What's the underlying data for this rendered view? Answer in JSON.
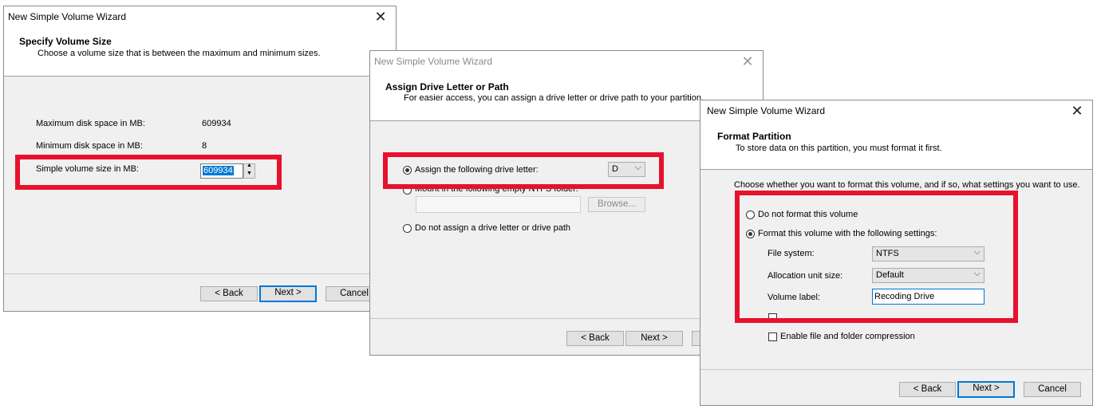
{
  "wizard1": {
    "title": "New Simple Volume Wizard",
    "heading": "Specify Volume Size",
    "subheading": "Choose a volume size that is between the maximum and minimum sizes.",
    "max_label": "Maximum disk space in MB:",
    "max_value": "609934",
    "min_label": "Minimum disk space in MB:",
    "min_value": "8",
    "size_label": "Simple volume size in MB:",
    "size_value": "609934",
    "back": "< Back",
    "next": "Next >",
    "cancel": "Cancel"
  },
  "wizard2": {
    "title": "New Simple Volume Wizard",
    "heading": "Assign Drive Letter or Path",
    "subheading": "For easier access, you can assign a drive letter or drive path to your partition.",
    "option_letter": "Assign the following drive letter:",
    "drive_letter": "D",
    "option_mount": "Mount in the following empty NTFS folder:",
    "browse": "Browse...",
    "option_none": "Do not assign a drive letter or drive path",
    "back": "< Back",
    "next": "Next >"
  },
  "wizard3": {
    "title": "New Simple Volume Wizard",
    "heading": "Format Partition",
    "subheading": "To store data on this partition, you must format it first.",
    "intro": "Choose whether you want to format this volume, and if so, what settings you want to use.",
    "option_noformat": "Do not format this volume",
    "option_format": "Format this volume with the following settings:",
    "fs_label": "File system:",
    "fs_value": "NTFS",
    "alloc_label": "Allocation unit size:",
    "alloc_value": "Default",
    "vol_label": "Volume label:",
    "vol_value": "Recoding Drive",
    "compression": "Enable file and folder compression",
    "back": "< Back",
    "next": "Next >",
    "cancel": "Cancel"
  },
  "highlight_color": "#e8112d",
  "accent_color": "#0078d7"
}
